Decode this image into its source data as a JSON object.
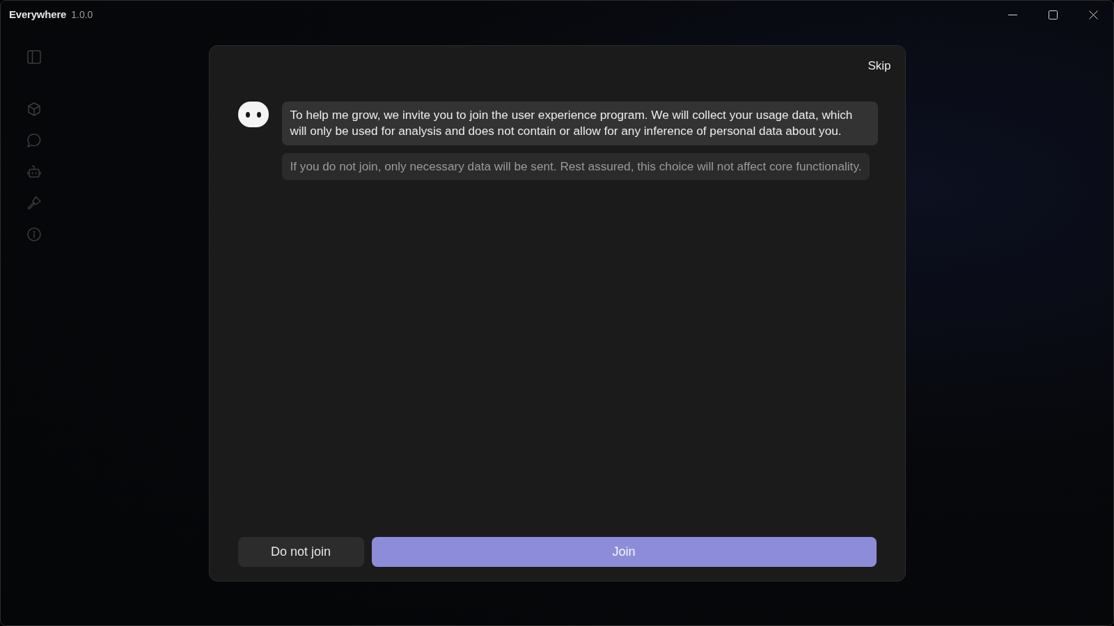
{
  "window": {
    "title": "Everywhere",
    "version": "1.0.0"
  },
  "dialog": {
    "skip_label": "Skip",
    "messages": [
      {
        "kind": "primary",
        "text": "To help me grow, we invite you to join the user experience program. We will collect your usage data, which will only be used for analysis and does not contain or allow for any inference of personal data about you."
      },
      {
        "kind": "muted",
        "text": "If you do not join, only necessary data will be sent. Rest assured, this choice will not affect core functionality."
      }
    ],
    "buttons": [
      {
        "kind": "secondary",
        "label": "Do not join"
      },
      {
        "kind": "primary",
        "label": "Join"
      }
    ]
  }
}
